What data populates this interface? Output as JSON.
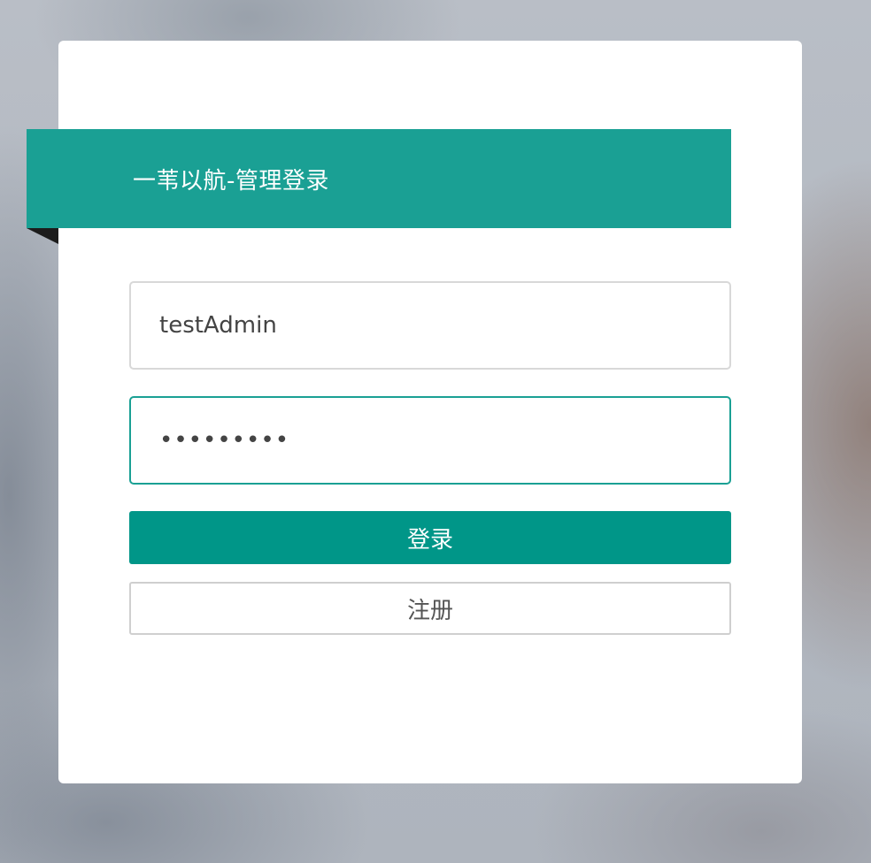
{
  "login_panel": {
    "title": "一苇以航-管理登录",
    "username": {
      "value": "testAdmin"
    },
    "password": {
      "value": "•••••••••"
    },
    "login_button_label": "登录",
    "register_button_label": "注册"
  },
  "colors": {
    "accent": "#1aa094",
    "button_primary": "#009688",
    "card_background": "#ffffff"
  }
}
